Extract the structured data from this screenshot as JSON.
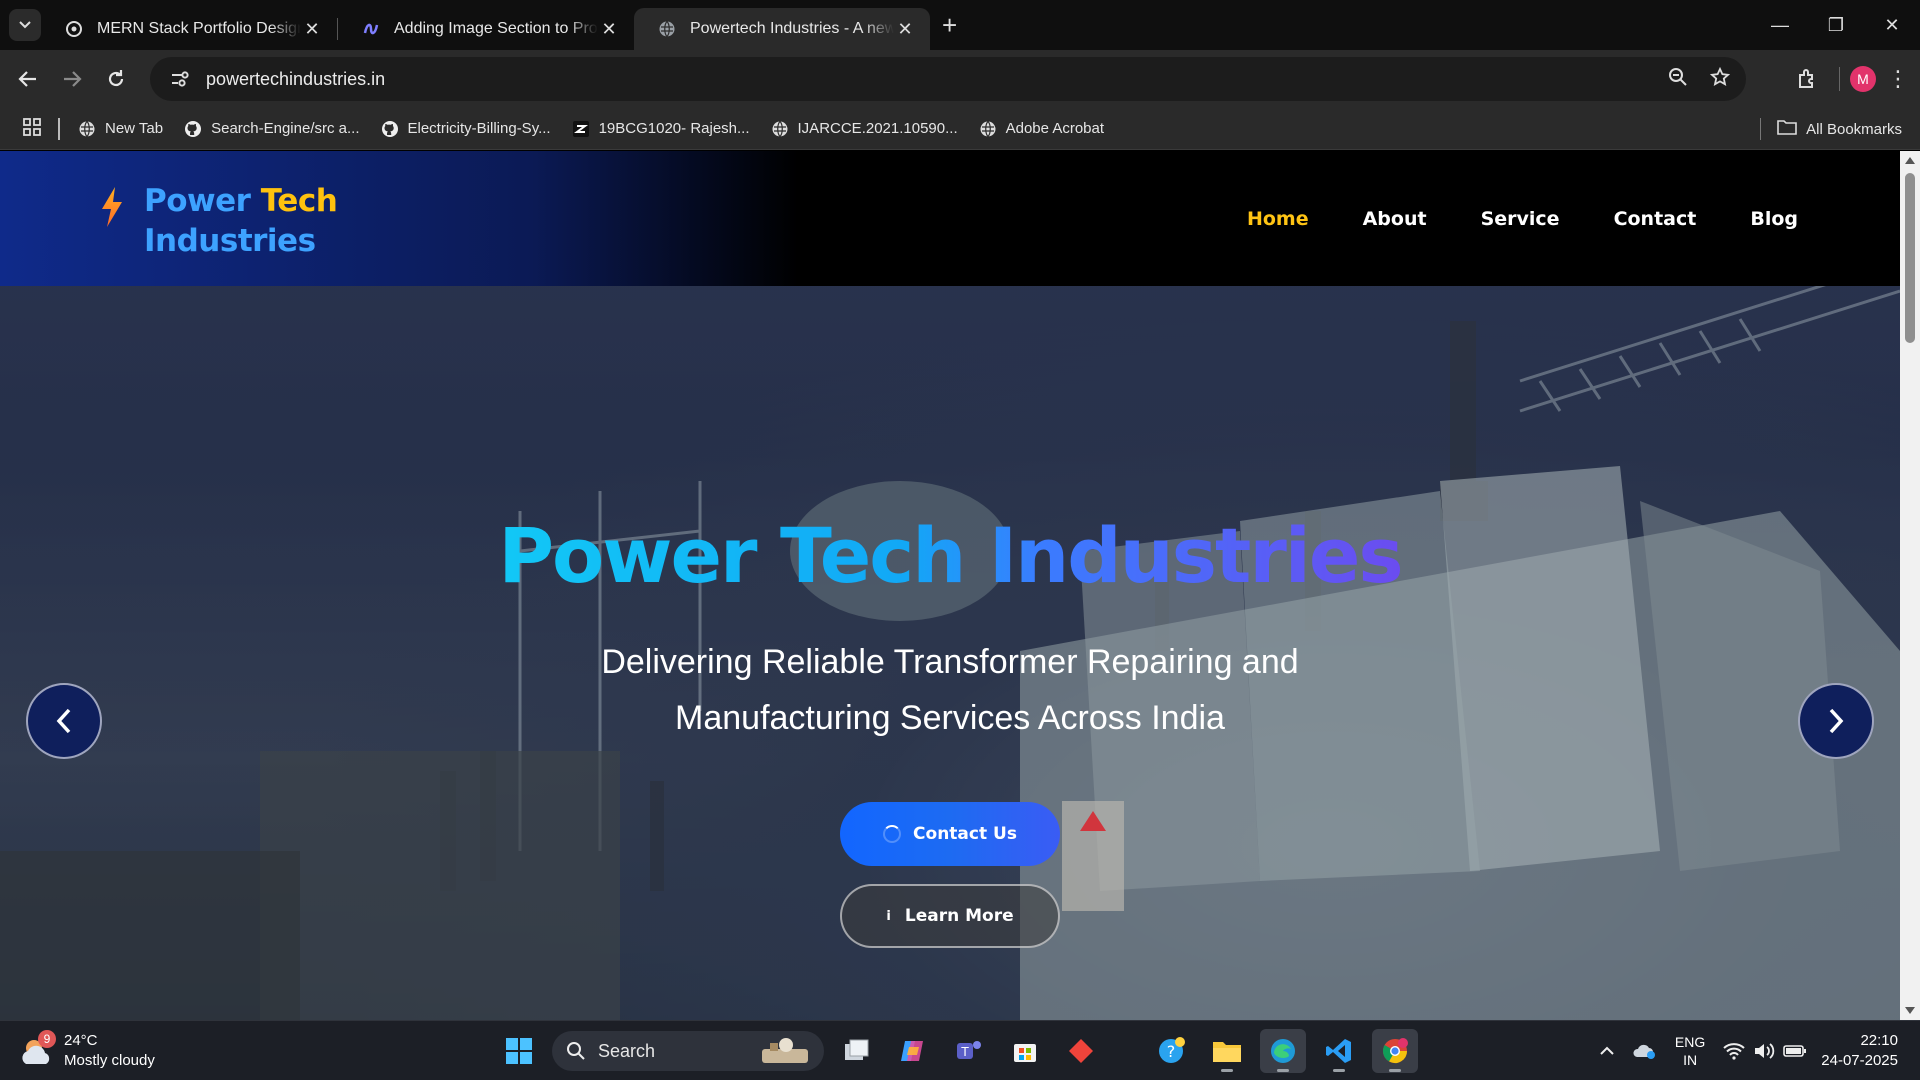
{
  "browser": {
    "tabs": [
      {
        "title": "MERN Stack Portfolio Design",
        "icon": "openai-icon"
      },
      {
        "title": "Adding Image Section to Project",
        "icon": "claude-icon"
      },
      {
        "title": "Powertech Industries - A new solution",
        "icon": "globe-icon",
        "active": true
      }
    ],
    "url": "powertechindustries.in",
    "profile_initial": "M",
    "bookmarks": [
      {
        "label": "New Tab",
        "icon": "globe-icon"
      },
      {
        "label": "Search-Engine/src a...",
        "icon": "github-icon"
      },
      {
        "label": "Electricity-Billing-Sy...",
        "icon": "github-icon"
      },
      {
        "label": "19BCG1020- Rajesh...",
        "icon": "app-icon"
      },
      {
        "label": "IJARCCE.2021.10590...",
        "icon": "globe-icon"
      },
      {
        "label": "Adobe Acrobat",
        "icon": "globe-icon"
      }
    ],
    "all_bookmarks": "All Bookmarks"
  },
  "site": {
    "logo": {
      "line1a": "Power",
      "line1b": "Tech",
      "line2": "Industries"
    },
    "nav": [
      {
        "label": "Home",
        "active": true
      },
      {
        "label": "About"
      },
      {
        "label": "Service"
      },
      {
        "label": "Contact"
      },
      {
        "label": "Blog"
      }
    ],
    "hero": {
      "title": "Power Tech Industries",
      "subtitle": "Delivering Reliable Transformer Repairing and Manufacturing Services Across India",
      "primary_button": "Contact Us",
      "secondary_button": "Learn More"
    },
    "colors": {
      "accent": "#ffc414",
      "brand_blue": "#3da2ff"
    }
  },
  "taskbar": {
    "weather": {
      "temp": "24°C",
      "condition": "Mostly cloudy",
      "badge": "9"
    },
    "search_placeholder": "Search",
    "language": {
      "line1": "ENG",
      "line2": "IN"
    },
    "time": "22:10",
    "date": "24-07-2025"
  }
}
